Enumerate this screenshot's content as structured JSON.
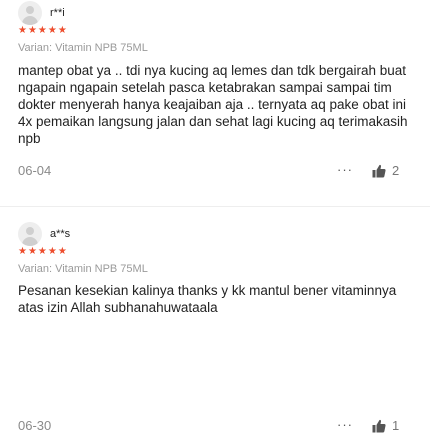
{
  "reviews": [
    {
      "username": "r**i",
      "stars": "★★★★★",
      "variant": "Varian: Vitamin NPB 75ML",
      "text": "mantep obat ya .. tdi nya kucing aq lemes dan tdk bergairah buat ngapain ngapain setelah pasca ketabrakan sampai sampai tim dokter menyerah hanya keajaiban aja .. ternyata aq pake obat ini 4x pemaikan langsung jalan dan sehat lagi kucing aq terimakasih npb",
      "date": "06-04",
      "more": "···",
      "likes": "2"
    },
    {
      "username": "a**s",
      "stars": "★★★★★",
      "variant": "Varian: Vitamin NPB 75ML",
      "text": "Pesanan kesekian kalinya thanks y kk mantul bener vitaminnya atas izin Allah subhanahuwataala",
      "date": "06-30",
      "more": "···",
      "likes": "1"
    }
  ],
  "colors": {
    "star": "#ee4d2d",
    "muted": "#9a9a9a"
  }
}
